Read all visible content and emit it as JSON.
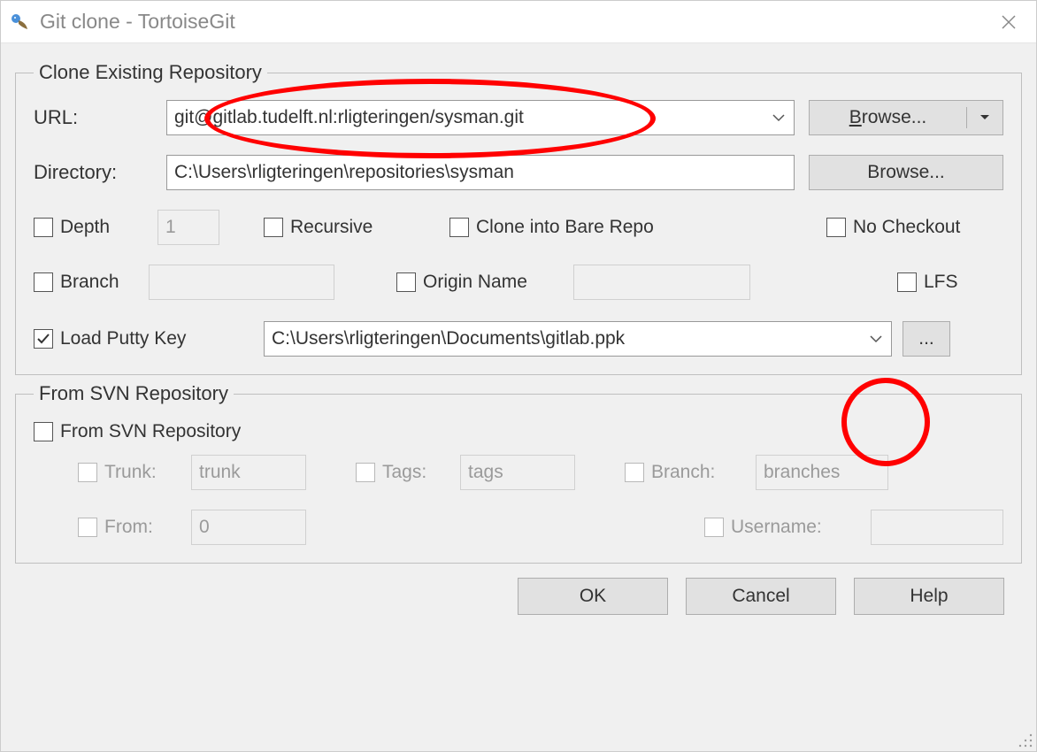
{
  "window": {
    "title": "Git clone - TortoiseGit"
  },
  "groupClone": {
    "legend": "Clone Existing Repository",
    "url": {
      "label": "URL:",
      "value": "git@gitlab.tudelft.nl:rligteringen/sysman.git",
      "browse": "Browse..."
    },
    "directory": {
      "label": "Directory:",
      "value": "C:\\Users\\rligteringen\\repositories\\sysman",
      "browse": "Browse..."
    },
    "options": {
      "depth": {
        "label": "Depth",
        "value": "1"
      },
      "recursive": {
        "label": "Recursive"
      },
      "cloneBare": {
        "label": "Clone into Bare Repo"
      },
      "noCheckout": {
        "label": "No Checkout"
      },
      "branch": {
        "label": "Branch",
        "value": ""
      },
      "originName": {
        "label": "Origin Name",
        "value": ""
      },
      "lfs": {
        "label": "LFS"
      }
    },
    "putty": {
      "label": "Load Putty Key",
      "checked": true,
      "value": "C:\\Users\\rligteringen\\Documents\\gitlab.ppk",
      "browse": "..."
    }
  },
  "groupSVN": {
    "legend": "From SVN Repository",
    "fromSvn": {
      "label": "From SVN Repository"
    },
    "trunk": {
      "label": "Trunk:",
      "value": "trunk"
    },
    "tags": {
      "label": "Tags:",
      "value": "tags"
    },
    "branch": {
      "label": "Branch:",
      "value": "branches"
    },
    "from": {
      "label": "From:",
      "value": "0"
    },
    "username": {
      "label": "Username:",
      "value": ""
    }
  },
  "buttons": {
    "ok": "OK",
    "cancel": "Cancel",
    "help": "Help"
  }
}
